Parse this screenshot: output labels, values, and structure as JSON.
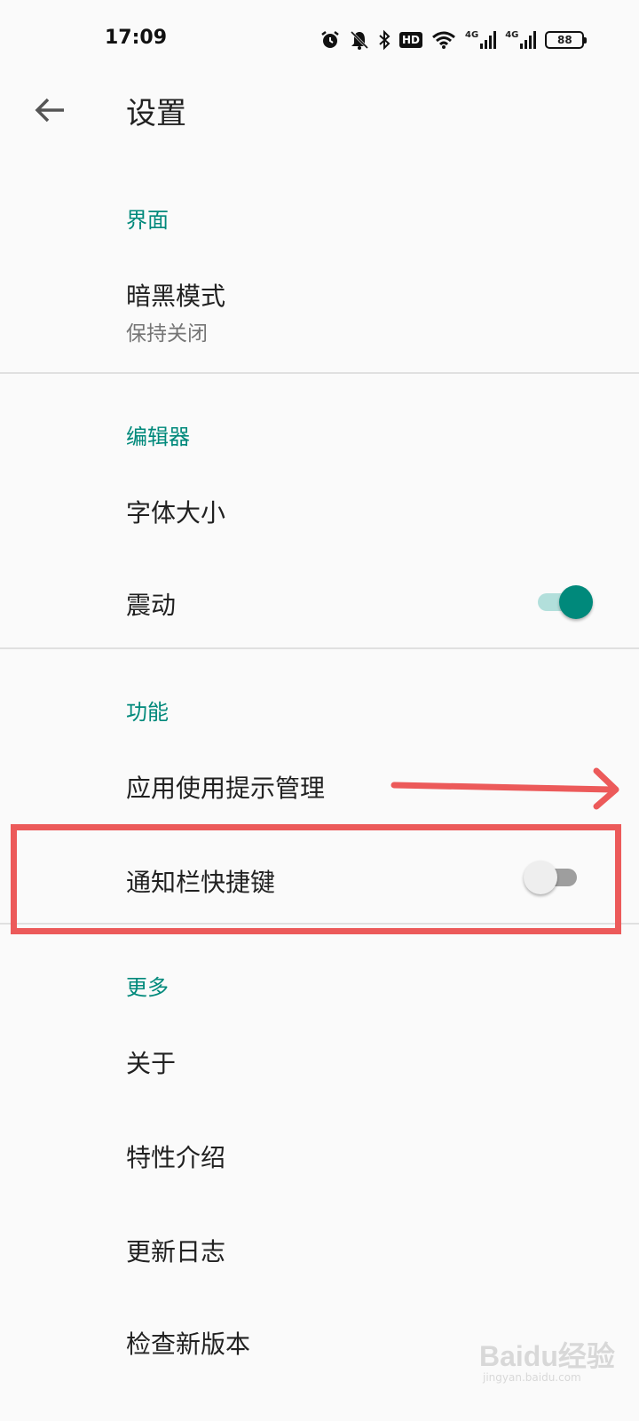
{
  "status_bar": {
    "time": "17:09",
    "icons": [
      "alarm-icon",
      "bell-off-icon",
      "bluetooth-icon",
      "hd-voice-icon",
      "wifi-icon",
      "signal-4g-icon",
      "signal-4g-icon",
      "battery-icon"
    ],
    "hd_label": "HD",
    "net1_label": "4G",
    "net2_label": "4G",
    "battery_level": "88"
  },
  "toolbar": {
    "back_icon": "arrow-left-icon",
    "title": "设置"
  },
  "sections": {
    "interface": {
      "header": "界面",
      "dark_mode": {
        "title": "暗黑模式",
        "subtitle": "保持关闭"
      }
    },
    "editor": {
      "header": "编辑器",
      "font_size": {
        "title": "字体大小"
      },
      "vibration": {
        "title": "震动",
        "enabled": true
      }
    },
    "features": {
      "header": "功能",
      "usage_hint": {
        "title": "应用使用提示管理"
      },
      "notification_shortcut": {
        "title": "通知栏快捷键",
        "enabled": false
      }
    },
    "more": {
      "header": "更多",
      "about": {
        "title": "关于"
      },
      "features_intro": {
        "title": "特性介绍"
      },
      "changelog": {
        "title": "更新日志"
      },
      "check_update": {
        "title": "检查新版本"
      }
    }
  },
  "colors": {
    "accent": "#00897b",
    "annotation": "#ec5a5a",
    "background": "#fafafa"
  },
  "watermark": {
    "logo": "Baidu经验",
    "url": "jingyan.baidu.com"
  }
}
